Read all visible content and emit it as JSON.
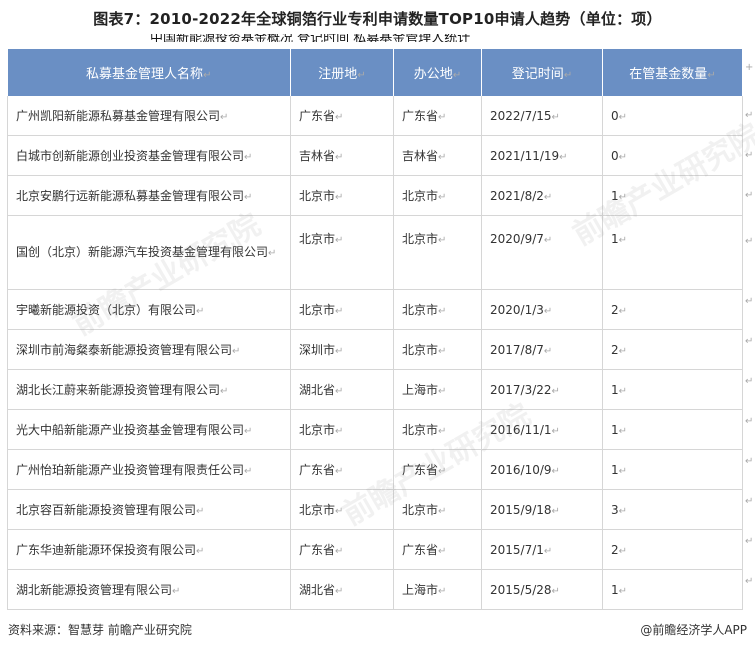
{
  "title": "图表7：2010-2022年全球铜箔行业专利申请数量TOP10申请人趋势（单位：项）",
  "cut_text": "中国新能源投资基金概况 登记时间 私募基金管理人统计",
  "table": {
    "headers": [
      "私募基金管理人名称",
      "注册地",
      "办公地",
      "登记时间",
      "在管基金数量"
    ],
    "rows": [
      {
        "name": "广州凯阳新能源私募基金管理有限公司",
        "reg": "广东省",
        "office": "广东省",
        "date": "2022/7/15",
        "count": "0"
      },
      {
        "name": "白城市创新能源创业投资基金管理有限公司",
        "reg": "吉林省",
        "office": "吉林省",
        "date": "2021/11/19",
        "count": "0"
      },
      {
        "name": "北京安鹏行远新能源私募基金管理有限公司",
        "reg": "北京市",
        "office": "北京市",
        "date": "2021/8/2",
        "count": "1"
      },
      {
        "name": "国创（北京）新能源汽车投资基金管理有限公司",
        "reg": "北京市",
        "office": "北京市",
        "date": "2020/9/7",
        "count": "1"
      },
      {
        "name": "宇曦新能源投资（北京）有限公司",
        "reg": "北京市",
        "office": "北京市",
        "date": "2020/1/3",
        "count": "2"
      },
      {
        "name": "深圳市前海粲泰新能源投资管理有限公司",
        "reg": "深圳市",
        "office": "北京市",
        "date": "2017/8/7",
        "count": "2"
      },
      {
        "name": "湖北长江蔚来新能源投资管理有限公司",
        "reg": "湖北省",
        "office": "上海市",
        "date": "2017/3/22",
        "count": "1"
      },
      {
        "name": "光大中船新能源产业投资基金管理有限公司",
        "reg": "北京市",
        "office": "北京市",
        "date": "2016/11/1",
        "count": "1"
      },
      {
        "name": "广州怡珀新能源产业投资管理有限责任公司",
        "reg": "广东省",
        "office": "广东省",
        "date": "2016/10/9",
        "count": "1"
      },
      {
        "name": "北京容百新能源投资管理有限公司",
        "reg": "北京市",
        "office": "北京市",
        "date": "2015/9/18",
        "count": "3"
      },
      {
        "name": "广东华迪新能源环保投资有限公司",
        "reg": "广东省",
        "office": "广东省",
        "date": "2015/7/1",
        "count": "2"
      },
      {
        "name": "湖北新能源投资管理有限公司",
        "reg": "湖北省",
        "office": "上海市",
        "date": "2015/5/28",
        "count": "1"
      }
    ]
  },
  "paragraph_mark": "↵",
  "edge_marks": [
    "+",
    "↵",
    "↵",
    "↵",
    "↵",
    "↵",
    "↵",
    "↵",
    "↵",
    "↵",
    "↵",
    "↵",
    "↵"
  ],
  "source": "资料来源：智慧芽 前瞻产业研究院",
  "brand": "@前瞻经济学人APP",
  "watermark": "前瞻产业研究院",
  "colors": {
    "header_bg": "#6a8fc4",
    "border": "#d6d6d6"
  }
}
